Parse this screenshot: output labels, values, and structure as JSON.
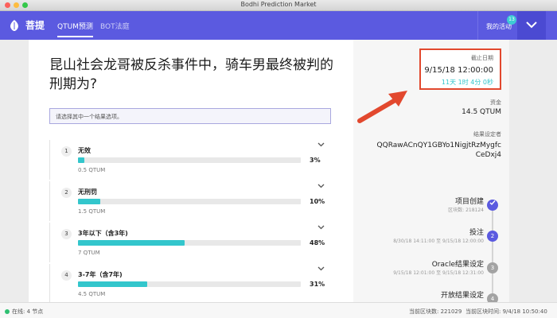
{
  "window": {
    "title": "Bodhi Prediction Market"
  },
  "nav": {
    "logo_text": "菩提",
    "tabs": [
      {
        "label": "QTUM预测"
      },
      {
        "label": "BOT法庭"
      }
    ],
    "activity_label": "我的活动",
    "activity_badge": "13"
  },
  "event": {
    "question": "昆山社会龙哥被反杀事件中，骑车男最终被判的刑期为?",
    "hint": "请选择其中一个结果选项。",
    "options": [
      {
        "num": "1",
        "name": "无效",
        "pct_label": "3%",
        "pct": 3,
        "amount": "0.5 QTUM"
      },
      {
        "num": "2",
        "name": "无刑罚",
        "pct_label": "10%",
        "pct": 10,
        "amount": "1.5 QTUM"
      },
      {
        "num": "3",
        "name": "3年以下（含3年)",
        "pct_label": "48%",
        "pct": 48,
        "amount": "7 QTUM"
      },
      {
        "num": "4",
        "name": "3-7年（含7年)",
        "pct_label": "31%",
        "pct": 31,
        "amount": "4.5 QTUM"
      }
    ]
  },
  "sidebar": {
    "deadline_label": "截止日期",
    "deadline_value": "9/15/18 12:00:00",
    "deadline_remaining": "11天 1时 4分 0秒",
    "funds_label": "资金",
    "funds_value": "14.5 QTUM",
    "setter_label": "结果设定者",
    "setter_address": "QQRawACnQY1GBYo1NigjtRzMygfcCeDxj4",
    "timeline": [
      {
        "title": "项目创建",
        "sub": "区块数: 218124",
        "marker": "check",
        "color": "#5b5ae0"
      },
      {
        "title": "投注",
        "sub": "8/30/18 14:11:00 至 9/15/18 12:00:00",
        "marker": "2",
        "color": "#5b5ae0"
      },
      {
        "title": "Oracle结果设定",
        "sub": "9/15/18 12:01:00 至 9/15/18 12:31:00",
        "marker": "3",
        "color": "#a3a3a3"
      },
      {
        "title": "开放结果设定",
        "sub": "",
        "marker": "4",
        "color": "#a3a3a3"
      }
    ]
  },
  "status": {
    "online": "在线: 4 节点",
    "block_count": "当前区块数: 221029",
    "block_time": "当前区块时间: 9/4/18 10:50:40"
  },
  "colors": {
    "primary": "#5b5ae0",
    "accent": "#33c6cc",
    "highlight": "#e2482e"
  }
}
